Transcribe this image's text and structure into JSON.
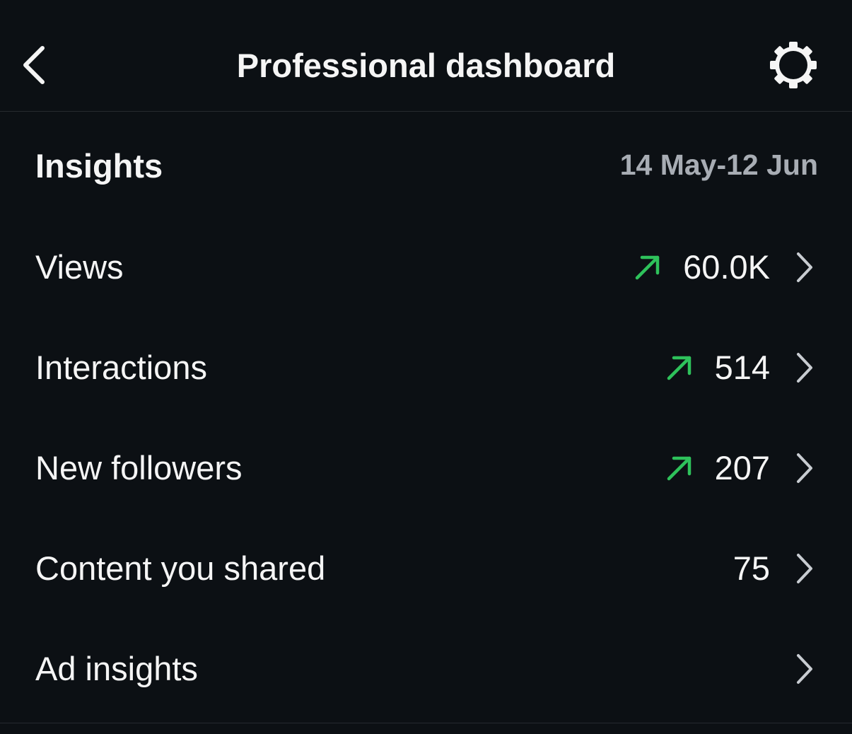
{
  "header": {
    "title": "Professional dashboard",
    "back_icon": "chevron-left-icon",
    "settings_icon": "gear-icon"
  },
  "insights": {
    "title": "Insights",
    "date_range": "14 May-12 Jun",
    "rows": [
      {
        "label": "Views",
        "value": "60.0K",
        "trend": "up"
      },
      {
        "label": "Interactions",
        "value": "514",
        "trend": "up"
      },
      {
        "label": "New followers",
        "value": "207",
        "trend": "up"
      },
      {
        "label": "Content you shared",
        "value": "75",
        "trend": "none"
      },
      {
        "label": "Ad insights",
        "value": "",
        "trend": "none"
      }
    ]
  },
  "colors": {
    "background": "#0c1014",
    "text": "#f5f5f5",
    "muted": "#a8adb4",
    "trend_up": "#2ec25b",
    "divider": "#262a2f"
  }
}
